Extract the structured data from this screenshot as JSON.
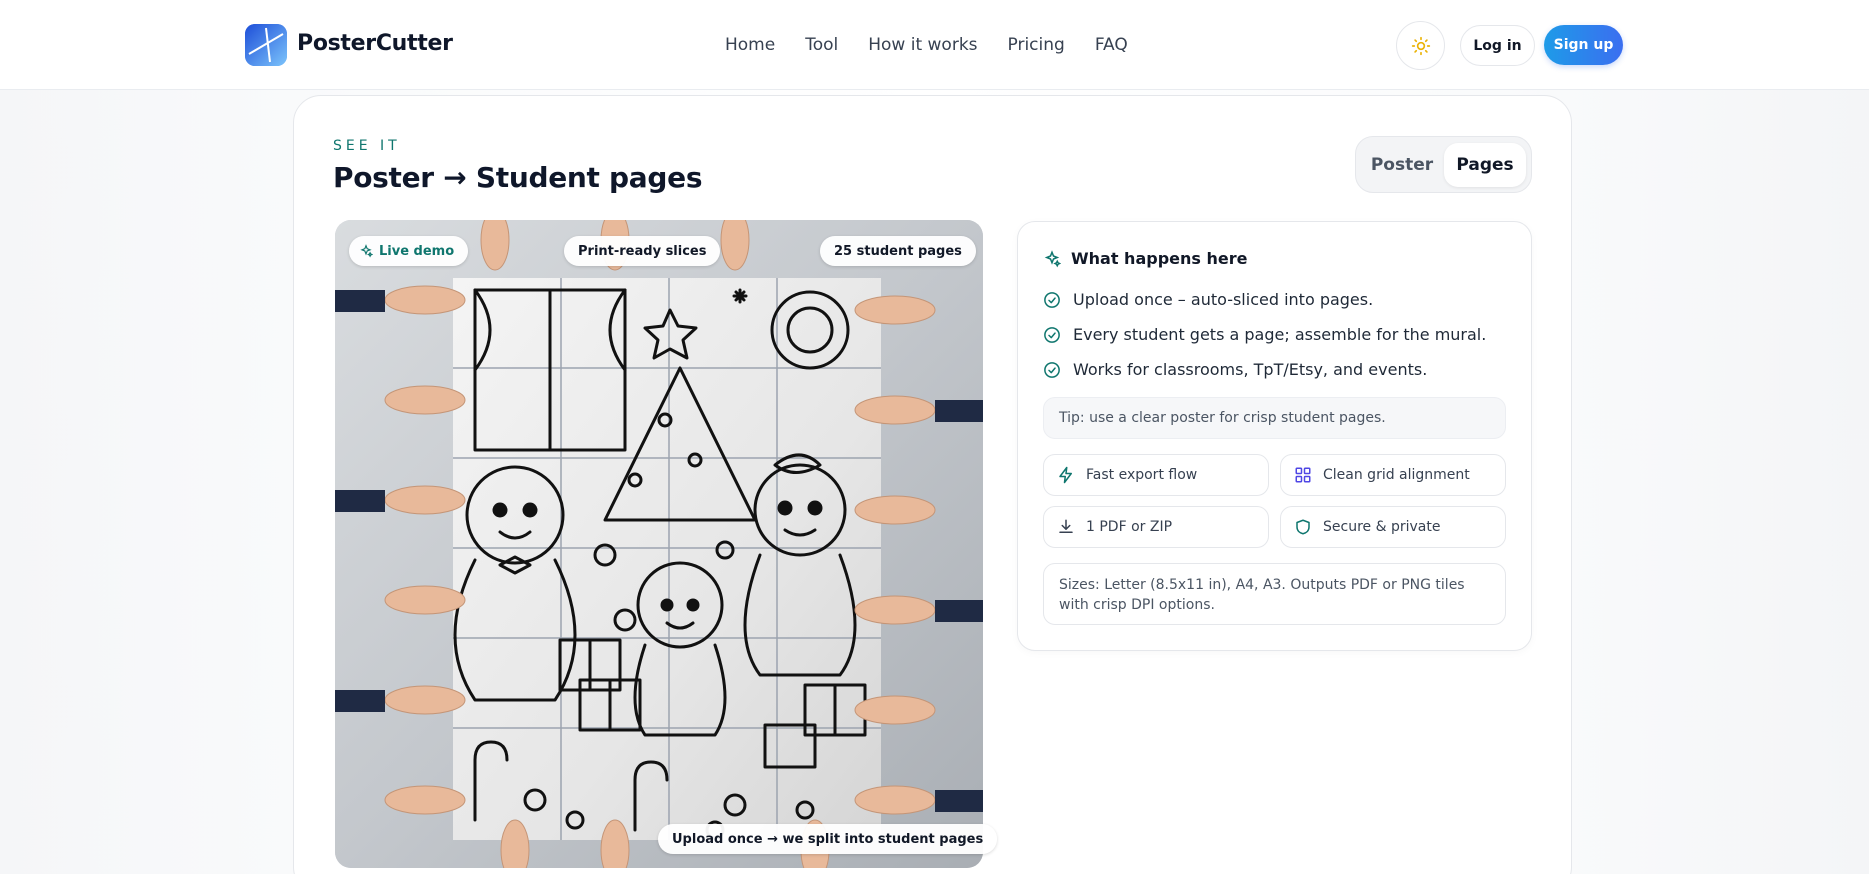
{
  "brand": {
    "name": "PosterCutter"
  },
  "nav": {
    "items": [
      "Home",
      "Tool",
      "How it works",
      "Pricing",
      "FAQ"
    ]
  },
  "header": {
    "theme_icon": "sun-icon",
    "login_label": "Log in",
    "signup_label": "Sign up"
  },
  "section": {
    "eyebrow": "SEE IT",
    "title": "Poster → Student pages",
    "toggle": {
      "options": [
        "Poster",
        "Pages"
      ],
      "selected": "Pages"
    }
  },
  "preview": {
    "badges": {
      "live": "Live demo",
      "print": "Print-ready slices",
      "count": "25 student pages",
      "bottom": "Upload once → we split into student pages"
    }
  },
  "info": {
    "heading": "What happens here",
    "bullets": [
      "Upload once – auto-sliced into pages.",
      "Every student gets a page; assemble for the mural.",
      "Works for classrooms, TpT/Etsy, and events."
    ],
    "tip": "Tip: use a clear poster for crisp student pages.",
    "features": [
      {
        "label": "Fast export flow",
        "icon": "lightning-icon"
      },
      {
        "label": "Clean grid alignment",
        "icon": "grid-icon"
      },
      {
        "label": "1 PDF or ZIP",
        "icon": "download-icon"
      },
      {
        "label": "Secure & private",
        "icon": "shield-icon"
      }
    ],
    "sizes": "Sizes: Letter (8.5x11 in), A4, A3. Outputs PDF or PNG tiles with crisp DPI options."
  },
  "colors": {
    "accent": "#0f766e",
    "primary": "#2563eb",
    "check": "#0f766e"
  }
}
